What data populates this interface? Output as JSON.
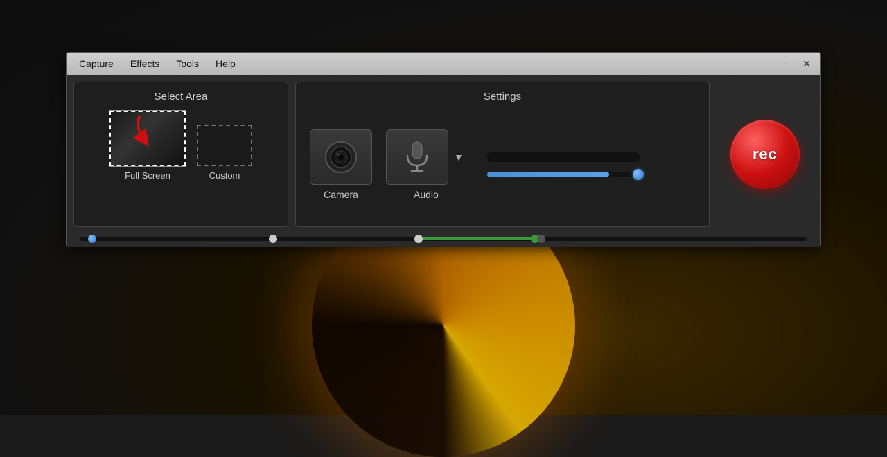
{
  "window": {
    "menu": {
      "capture": "Capture",
      "effects": "Effects",
      "tools": "Tools",
      "help": "Help"
    },
    "controls": {
      "minimize": "−",
      "close": "✕"
    }
  },
  "select_area": {
    "title": "Select Area",
    "full_screen_label": "Full Screen",
    "custom_label": "Custom"
  },
  "settings": {
    "title": "Settings",
    "camera_label": "Camera",
    "audio_label": "Audio",
    "rec_label": "rec"
  }
}
